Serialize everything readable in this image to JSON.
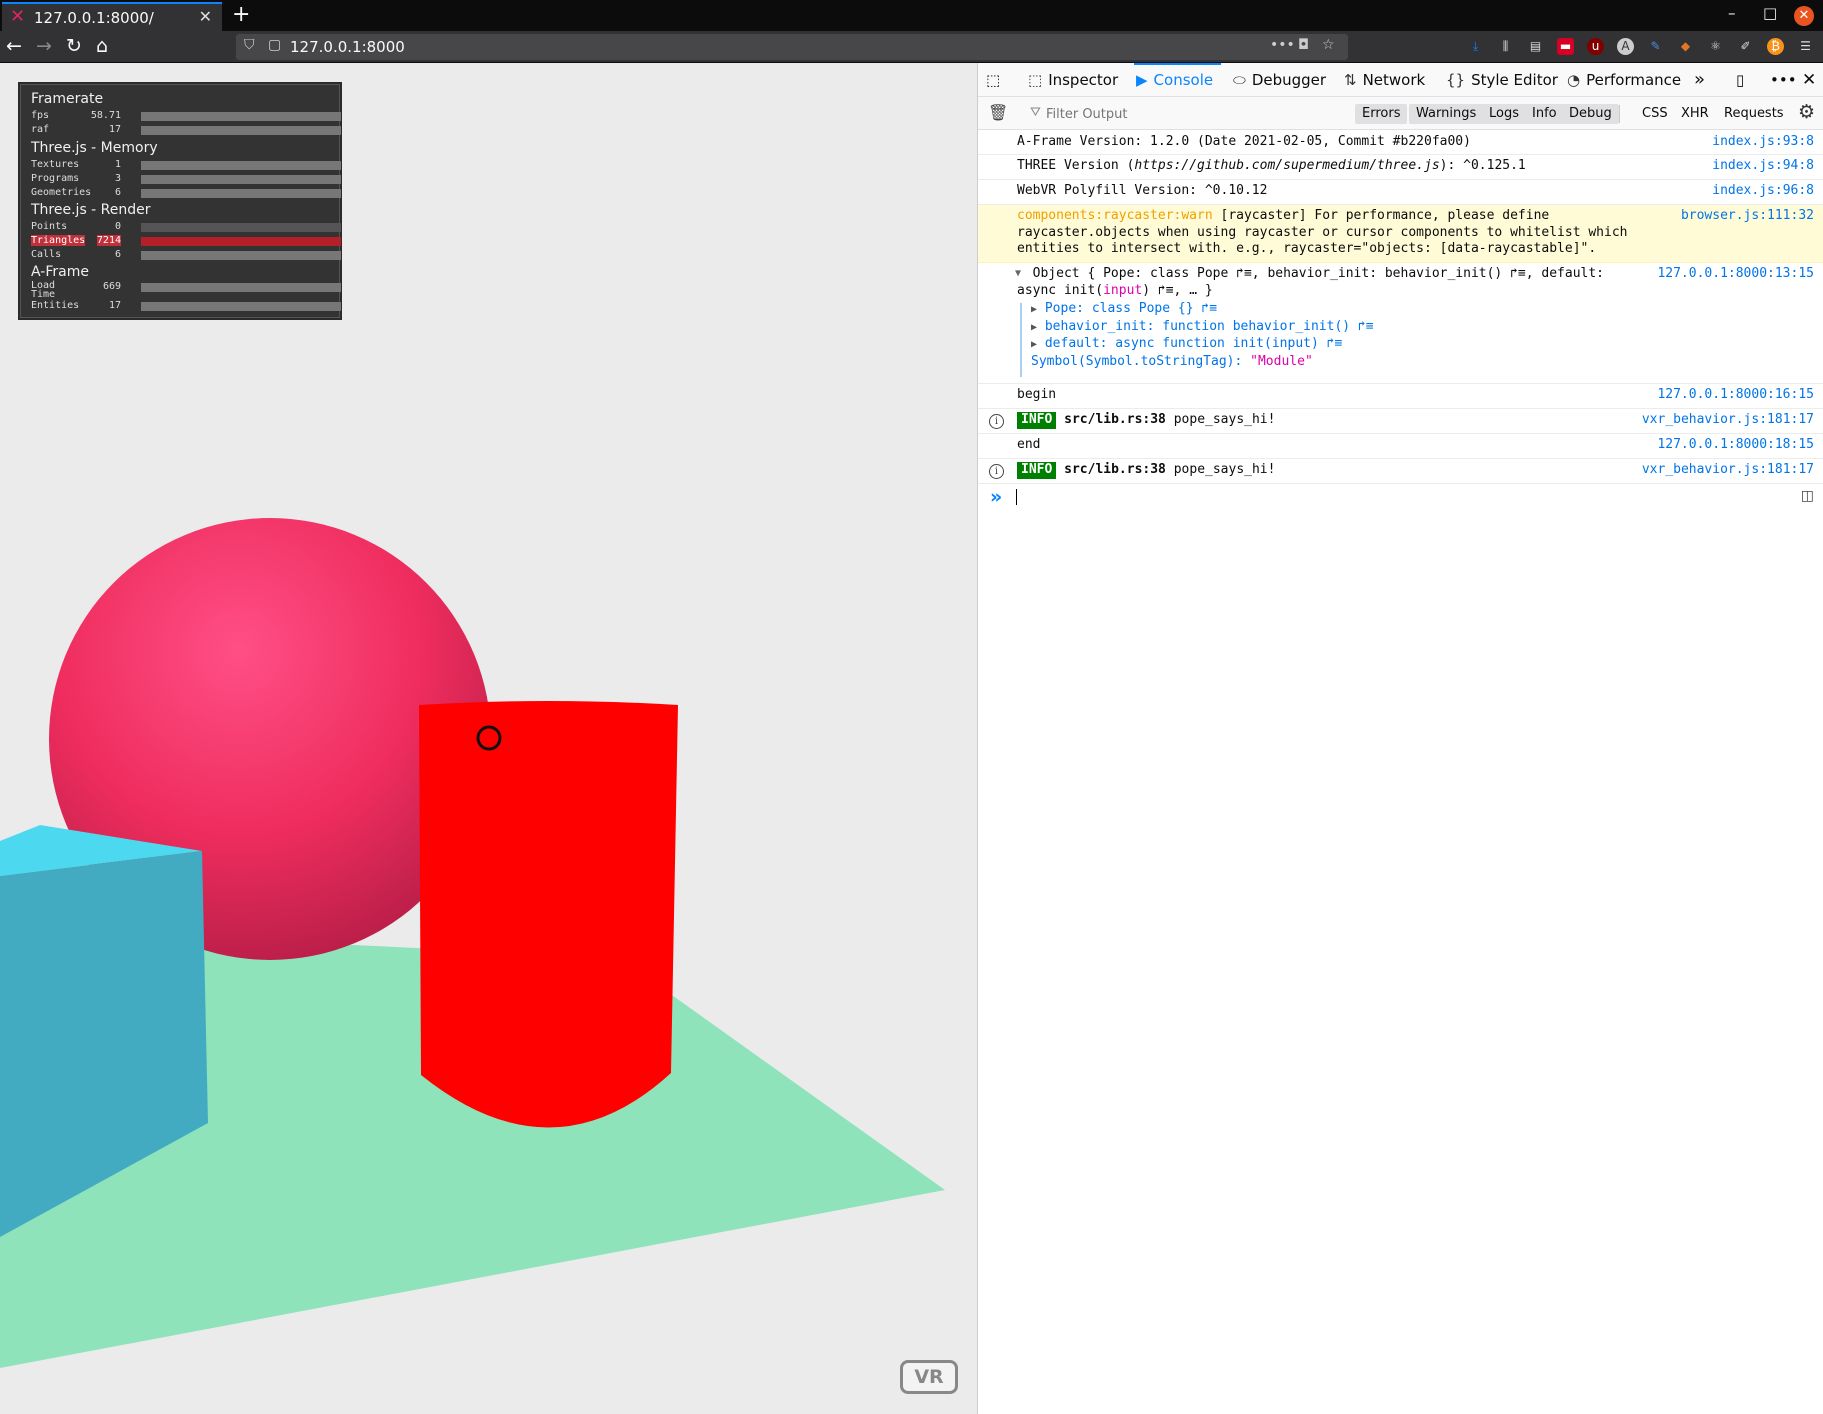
{
  "browser": {
    "tab_title": "127.0.0.1:8000/",
    "tab_close": "✕",
    "new_tab": "+",
    "url": "127.0.0.1:8000",
    "window_controls": {
      "minimize": "–",
      "maximize": "□",
      "close": "✕"
    }
  },
  "stats": {
    "framerate": {
      "title": "Framerate",
      "rows": [
        {
          "label": "fps",
          "value": "58.71"
        },
        {
          "label": "raf",
          "value": "17"
        }
      ]
    },
    "memory": {
      "title": "Three.js - Memory",
      "rows": [
        {
          "label": "Textures",
          "value": "1"
        },
        {
          "label": "Programs",
          "value": "3"
        },
        {
          "label": "Geometries",
          "value": "6"
        }
      ]
    },
    "render": {
      "title": "Three.js - Render",
      "rows": [
        {
          "label": "Points",
          "value": "0"
        },
        {
          "label": "Triangles",
          "value": "7214"
        },
        {
          "label": "Calls",
          "value": "6"
        }
      ]
    },
    "aframe": {
      "title": "A-Frame",
      "rows": [
        {
          "label": "Load",
          "label2": "Time",
          "value": "669"
        },
        {
          "label": "Entities",
          "value": "17"
        }
      ]
    }
  },
  "scene": {
    "vr_button": "VR",
    "colors": {
      "background": "#ebebeb",
      "plane": "#8ee3bb",
      "sphere": "#ef2d5e",
      "box_top": "#4cd9ef",
      "box_side": "#42abc2",
      "cylinder": "#ff0000"
    }
  },
  "devtools": {
    "tabs": [
      "Inspector",
      "Console",
      "Debugger",
      "Network",
      "Style Editor",
      "Performance"
    ],
    "selected_tab": "Console",
    "filter_placeholder": "Filter Output",
    "filter_buttons": [
      "Errors",
      "Warnings",
      "Logs",
      "Info",
      "Debug"
    ],
    "filter_extra": [
      "CSS",
      "XHR",
      "Requests"
    ]
  },
  "console": {
    "messages": [
      {
        "text": "A-Frame Version: 1.2.0 (Date 2021-02-05, Commit #b220fa00)",
        "source": "index.js:93:8"
      },
      {
        "text_a": "THREE Version (",
        "text_url": "https://github.com/supermedium/three.js",
        "text_b": "): ^0.125.1",
        "source": "index.js:94:8"
      },
      {
        "text": "WebVR Polyfill Version: ^0.10.12",
        "source": "index.js:96:8"
      },
      {
        "warn_label": "components:raycaster:warn",
        "line1": " [raycaster] For performance, please define",
        "line2": "raycaster.objects when using raycaster or cursor components to whitelist which",
        "line3": "entities to intersect with. e.g., raycaster=\"objects: [data-raycastable]\".",
        "source": "browser.js:111:32"
      },
      {
        "obj_line1": "Object { Pope: class Pope ↱≡, behavior_init: behavior_init() ↱≡, default:",
        "obj_line2a": "async init(",
        "obj_line2b": "input",
        "obj_line2c": ") ↱≡, … }",
        "props": [
          "Pope: class Pope {} ↱≡",
          "behavior_init: function behavior_init() ↱≡",
          "default: async function init(input) ↱≡"
        ],
        "symbol_key": "Symbol(Symbol.toStringTag): ",
        "symbol_val": "\"Module\"",
        "source": "127.0.0.1:8000:13:15"
      },
      {
        "text": "begin",
        "source": "127.0.0.1:8000:16:15"
      },
      {
        "badge": "INFO",
        "file": "src/lib.rs:38",
        "text": " pope_says_hi!",
        "source": "vxr_behavior.js:181:17"
      },
      {
        "text": "end",
        "source": "127.0.0.1:8000:18:15"
      },
      {
        "badge": "INFO",
        "file": "src/lib.rs:38",
        "text": " pope_says_hi!",
        "source": "vxr_behavior.js:181:17"
      }
    ],
    "prompt_symbol": "»"
  }
}
